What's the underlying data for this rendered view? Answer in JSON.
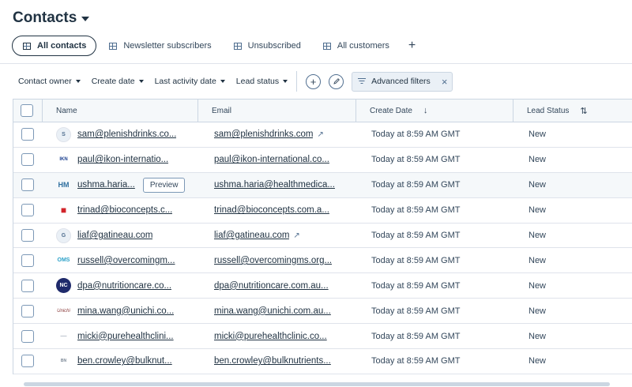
{
  "header": {
    "title": "Contacts"
  },
  "tabs": [
    {
      "label": "All contacts"
    },
    {
      "label": "Newsletter subscribers"
    },
    {
      "label": "Unsubscribed"
    },
    {
      "label": "All customers"
    }
  ],
  "add_tab_label": "+",
  "filters": {
    "contact_owner": "Contact owner",
    "create_date": "Create date",
    "last_activity_date": "Last activity date",
    "lead_status": "Lead status",
    "advanced_filters": "Advanced filters"
  },
  "table": {
    "columns": {
      "name": "Name",
      "email": "Email",
      "create_date": "Create Date",
      "lead_status": "Lead Status"
    },
    "sort_icon": "↓",
    "sortable_icon": "⇅",
    "preview_label": "Preview",
    "rows": [
      {
        "name": "sam@plenishdrinks.co...",
        "email": "sam@plenishdrinks.com",
        "created": "Today at 8:59 AM GMT",
        "status": "New",
        "logo": "S"
      },
      {
        "name": "paul@ikon-internatio...",
        "email": "paul@ikon-international.co...",
        "created": "Today at 8:59 AM GMT",
        "status": "New",
        "logo": "IKN"
      },
      {
        "name": "ushma.haria...",
        "email": "ushma.haria@healthmedica...",
        "created": "Today at 8:59 AM GMT",
        "status": "New",
        "logo": "HM"
      },
      {
        "name": "trinad@bioconcepts.c...",
        "email": "trinad@bioconcepts.com.a...",
        "created": "Today at 8:59 AM GMT",
        "status": "New",
        "logo": "■"
      },
      {
        "name": "liaf@gatineau.com",
        "email": "liaf@gatineau.com",
        "created": "Today at 8:59 AM GMT",
        "status": "New",
        "logo": "G"
      },
      {
        "name": "russell@overcomingm...",
        "email": "russell@overcomingms.org...",
        "created": "Today at 8:59 AM GMT",
        "status": "New",
        "logo": "OMS"
      },
      {
        "name": "dpa@nutritioncare.co...",
        "email": "dpa@nutritioncare.com.au...",
        "created": "Today at 8:59 AM GMT",
        "status": "New",
        "logo": "NC"
      },
      {
        "name": "mina.wang@unichi.co...",
        "email": "mina.wang@unichi.com.au...",
        "created": "Today at 8:59 AM GMT",
        "status": "New",
        "logo": "Unichi"
      },
      {
        "name": "micki@purehealthclini...",
        "email": "micki@purehealthclinic.co...",
        "created": "Today at 8:59 AM GMT",
        "status": "New",
        "logo": "—"
      },
      {
        "name": "ben.crowley@bulknut...",
        "email": "ben.crowley@bulknutrients...",
        "created": "Today at 8:59 AM GMT",
        "status": "New",
        "logo": "BN"
      }
    ]
  },
  "colors": {
    "text": "#33475b",
    "dark": "#213343",
    "border": "#cbd6e2",
    "header_bg": "#f5f8fa"
  },
  "icons": {
    "external_link": "external-link-icon",
    "sort": "arrow-down-icon",
    "table": "table-icon"
  }
}
